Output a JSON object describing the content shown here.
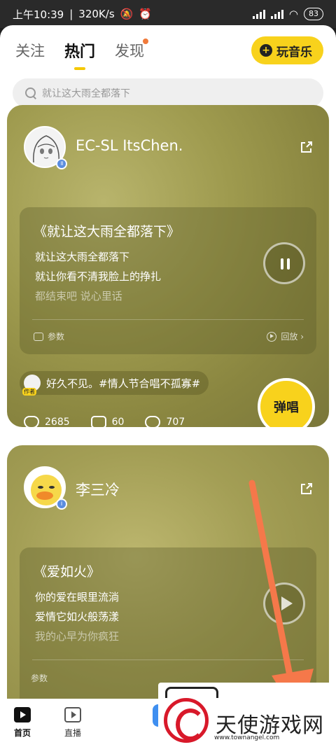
{
  "status": {
    "time": "上午10:39",
    "net_speed": "320K/s",
    "battery": "83"
  },
  "topnav": {
    "tabs": [
      {
        "label": "关注"
      },
      {
        "label": "热门"
      },
      {
        "label": "发现"
      }
    ],
    "play_music": "玩音乐"
  },
  "search": {
    "placeholder": "就让这大雨全都落下"
  },
  "cards": [
    {
      "username": "EC-SL ItsChen.",
      "song_title": "《就让这大雨全都落下》",
      "lyrics": [
        "就让这大雨全都落下",
        "就让你看不清我脸上的挣扎",
        "都结束吧 说心里话"
      ],
      "params": "参数",
      "replay": "回放 ›",
      "author_tag": "作者",
      "caption": "好久不见。#情人节合唱不孤寡#",
      "likes": "2685",
      "comments": "60",
      "gifts": "707",
      "sing_button": "弹唱"
    },
    {
      "username": "李三冷",
      "song_title": "《爱如火》",
      "lyrics": [
        "你的爱在眼里流淌",
        "爱情它如火般荡漾",
        "我的心早为你疯狂"
      ],
      "params": "参数"
    }
  ],
  "bottomnav": {
    "items": [
      {
        "label": "首页"
      },
      {
        "label": "直播"
      }
    ]
  },
  "watermark": {
    "text": "天使游戏网",
    "url": "www.townangel.com"
  },
  "colors": {
    "accent_yellow": "#f8d21c",
    "card_olive": "#9e9a4e",
    "arrow_orange": "#f5784a"
  }
}
